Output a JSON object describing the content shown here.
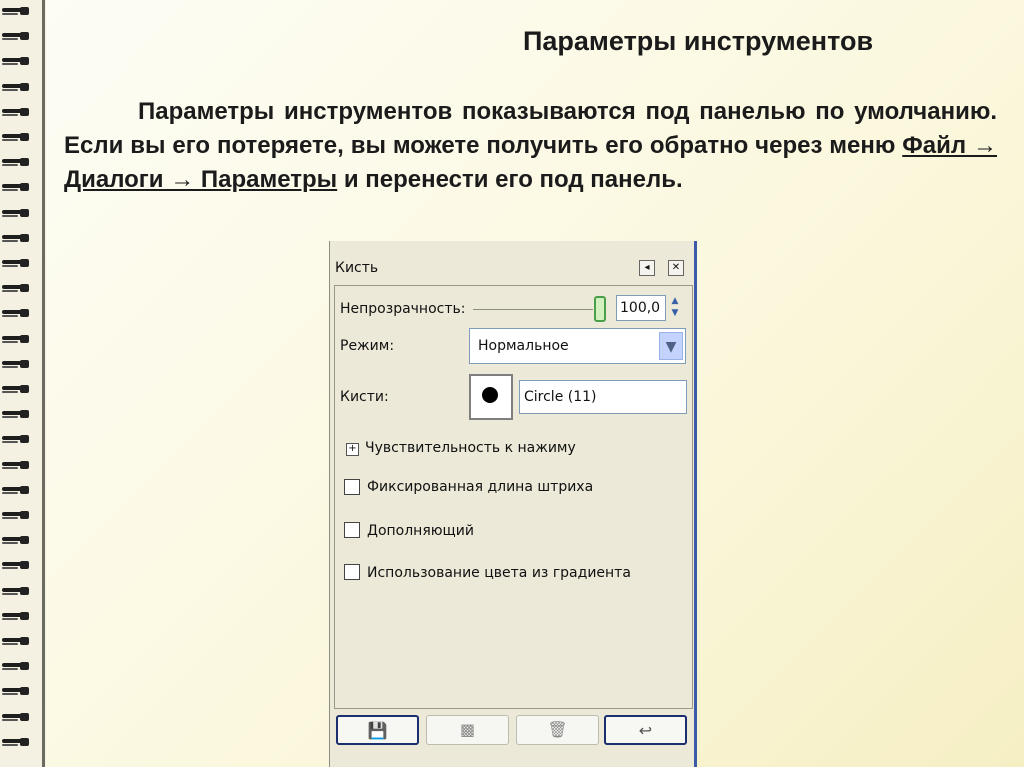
{
  "slide": {
    "title": "Параметры инструментов",
    "paragraph": {
      "part1": "Параметры инструментов показываются под панелью по умолчанию. Если вы его потеряете, вы можете получить его обратно через меню ",
      "menu_path": "Файл → Диалоги → Параметры",
      "part2": " и перенести его под панель."
    }
  },
  "dialog": {
    "title": "Кисть",
    "opacity": {
      "label": "Непрозрачность:",
      "value": "100,0"
    },
    "mode": {
      "label": "Режим:",
      "selected": "Нормальное"
    },
    "brushes": {
      "label": "Кисти:",
      "value": "Circle (11)"
    },
    "pressure": {
      "label": "Чувствительность к нажиму"
    },
    "checkboxes": [
      {
        "label": "Фиксированная длина штриха"
      },
      {
        "label": "Дополняющий"
      },
      {
        "label": "Использование цвета из градиента"
      }
    ],
    "buttons": [
      {
        "icon": "save-icon",
        "glyph": "💾"
      },
      {
        "icon": "restore-icon",
        "glyph": "▩"
      },
      {
        "icon": "delete-icon",
        "glyph": "🗑"
      },
      {
        "icon": "reset-icon",
        "glyph": "↩"
      }
    ]
  }
}
